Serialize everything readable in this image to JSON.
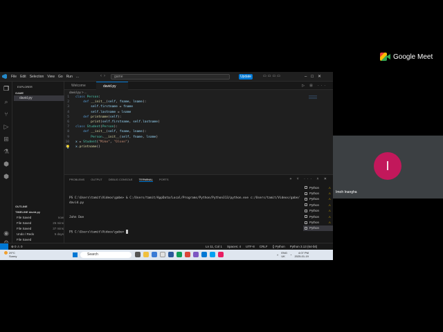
{
  "meet": {
    "brand": "Google Meet",
    "participant_initial": "I",
    "participant_name": "Imoh Inangha"
  },
  "titlebar": {
    "menu": [
      "File",
      "Edit",
      "Selection",
      "View",
      "Go",
      "Run",
      "..."
    ],
    "search_text": "game",
    "update_label": "Update"
  },
  "sidebar": {
    "title": "EXPLORER",
    "folder": "GAME",
    "file": "david.py",
    "outline": "OUTLINE",
    "timeline": "TIMELINE  david.py",
    "timeline_items": [
      {
        "label": "File Saved",
        "time": "now"
      },
      {
        "label": "File Saved",
        "time": "26 mins"
      },
      {
        "label": "File Saved",
        "time": "37 mins"
      },
      {
        "label": "Undo / Redo",
        "time": "5 days"
      },
      {
        "label": "File Saved",
        "time": ""
      }
    ]
  },
  "tabs": [
    {
      "label": "Welcome",
      "active": false
    },
    {
      "label": "david.py",
      "active": true
    }
  ],
  "breadcrumb": "david.py > ...",
  "code_lines": [
    "1",
    "2",
    "3",
    "4",
    "5",
    "6",
    "7",
    "8",
    "9",
    "10",
    "11"
  ],
  "panel": {
    "tabs": [
      "PROBLEMS",
      "OUTPUT",
      "DEBUG CONSOLE",
      "TERMINAL",
      "PORTS"
    ],
    "active_tab": "TERMINAL",
    "terminal_lines": [
      "PS C:\\Users\\tamit\\Videos\\gabe> & C:/Users/tamit/AppData/Local/Programs/Python/Python313/python.exe c:/Users/tamit/Videos/gabe/david.py",
      "John Doe",
      "PS C:\\Users\\tamit\\Videos\\gabe> "
    ],
    "terminals": [
      "Python",
      "Python",
      "Python",
      "Python",
      "Python",
      "Python",
      "Python",
      "Python"
    ],
    "active_terminal": 7
  },
  "statusbar": {
    "left": "⊗ 0 ⚠ 0",
    "items": [
      "Ln 11, Col 1",
      "Spaces: 4",
      "UTF-8",
      "CRLF",
      "{} Python",
      "Python 3.13 (64-bit)"
    ]
  },
  "taskbar": {
    "temp": "29°C",
    "weather": "Sunny",
    "search_label": "Search",
    "lang": "ENG",
    "region": "UK",
    "time": "4:07 PM",
    "date": "2025-01-19"
  },
  "colors": {
    "accent": "#0078d4",
    "avatar": "#c2185b"
  }
}
